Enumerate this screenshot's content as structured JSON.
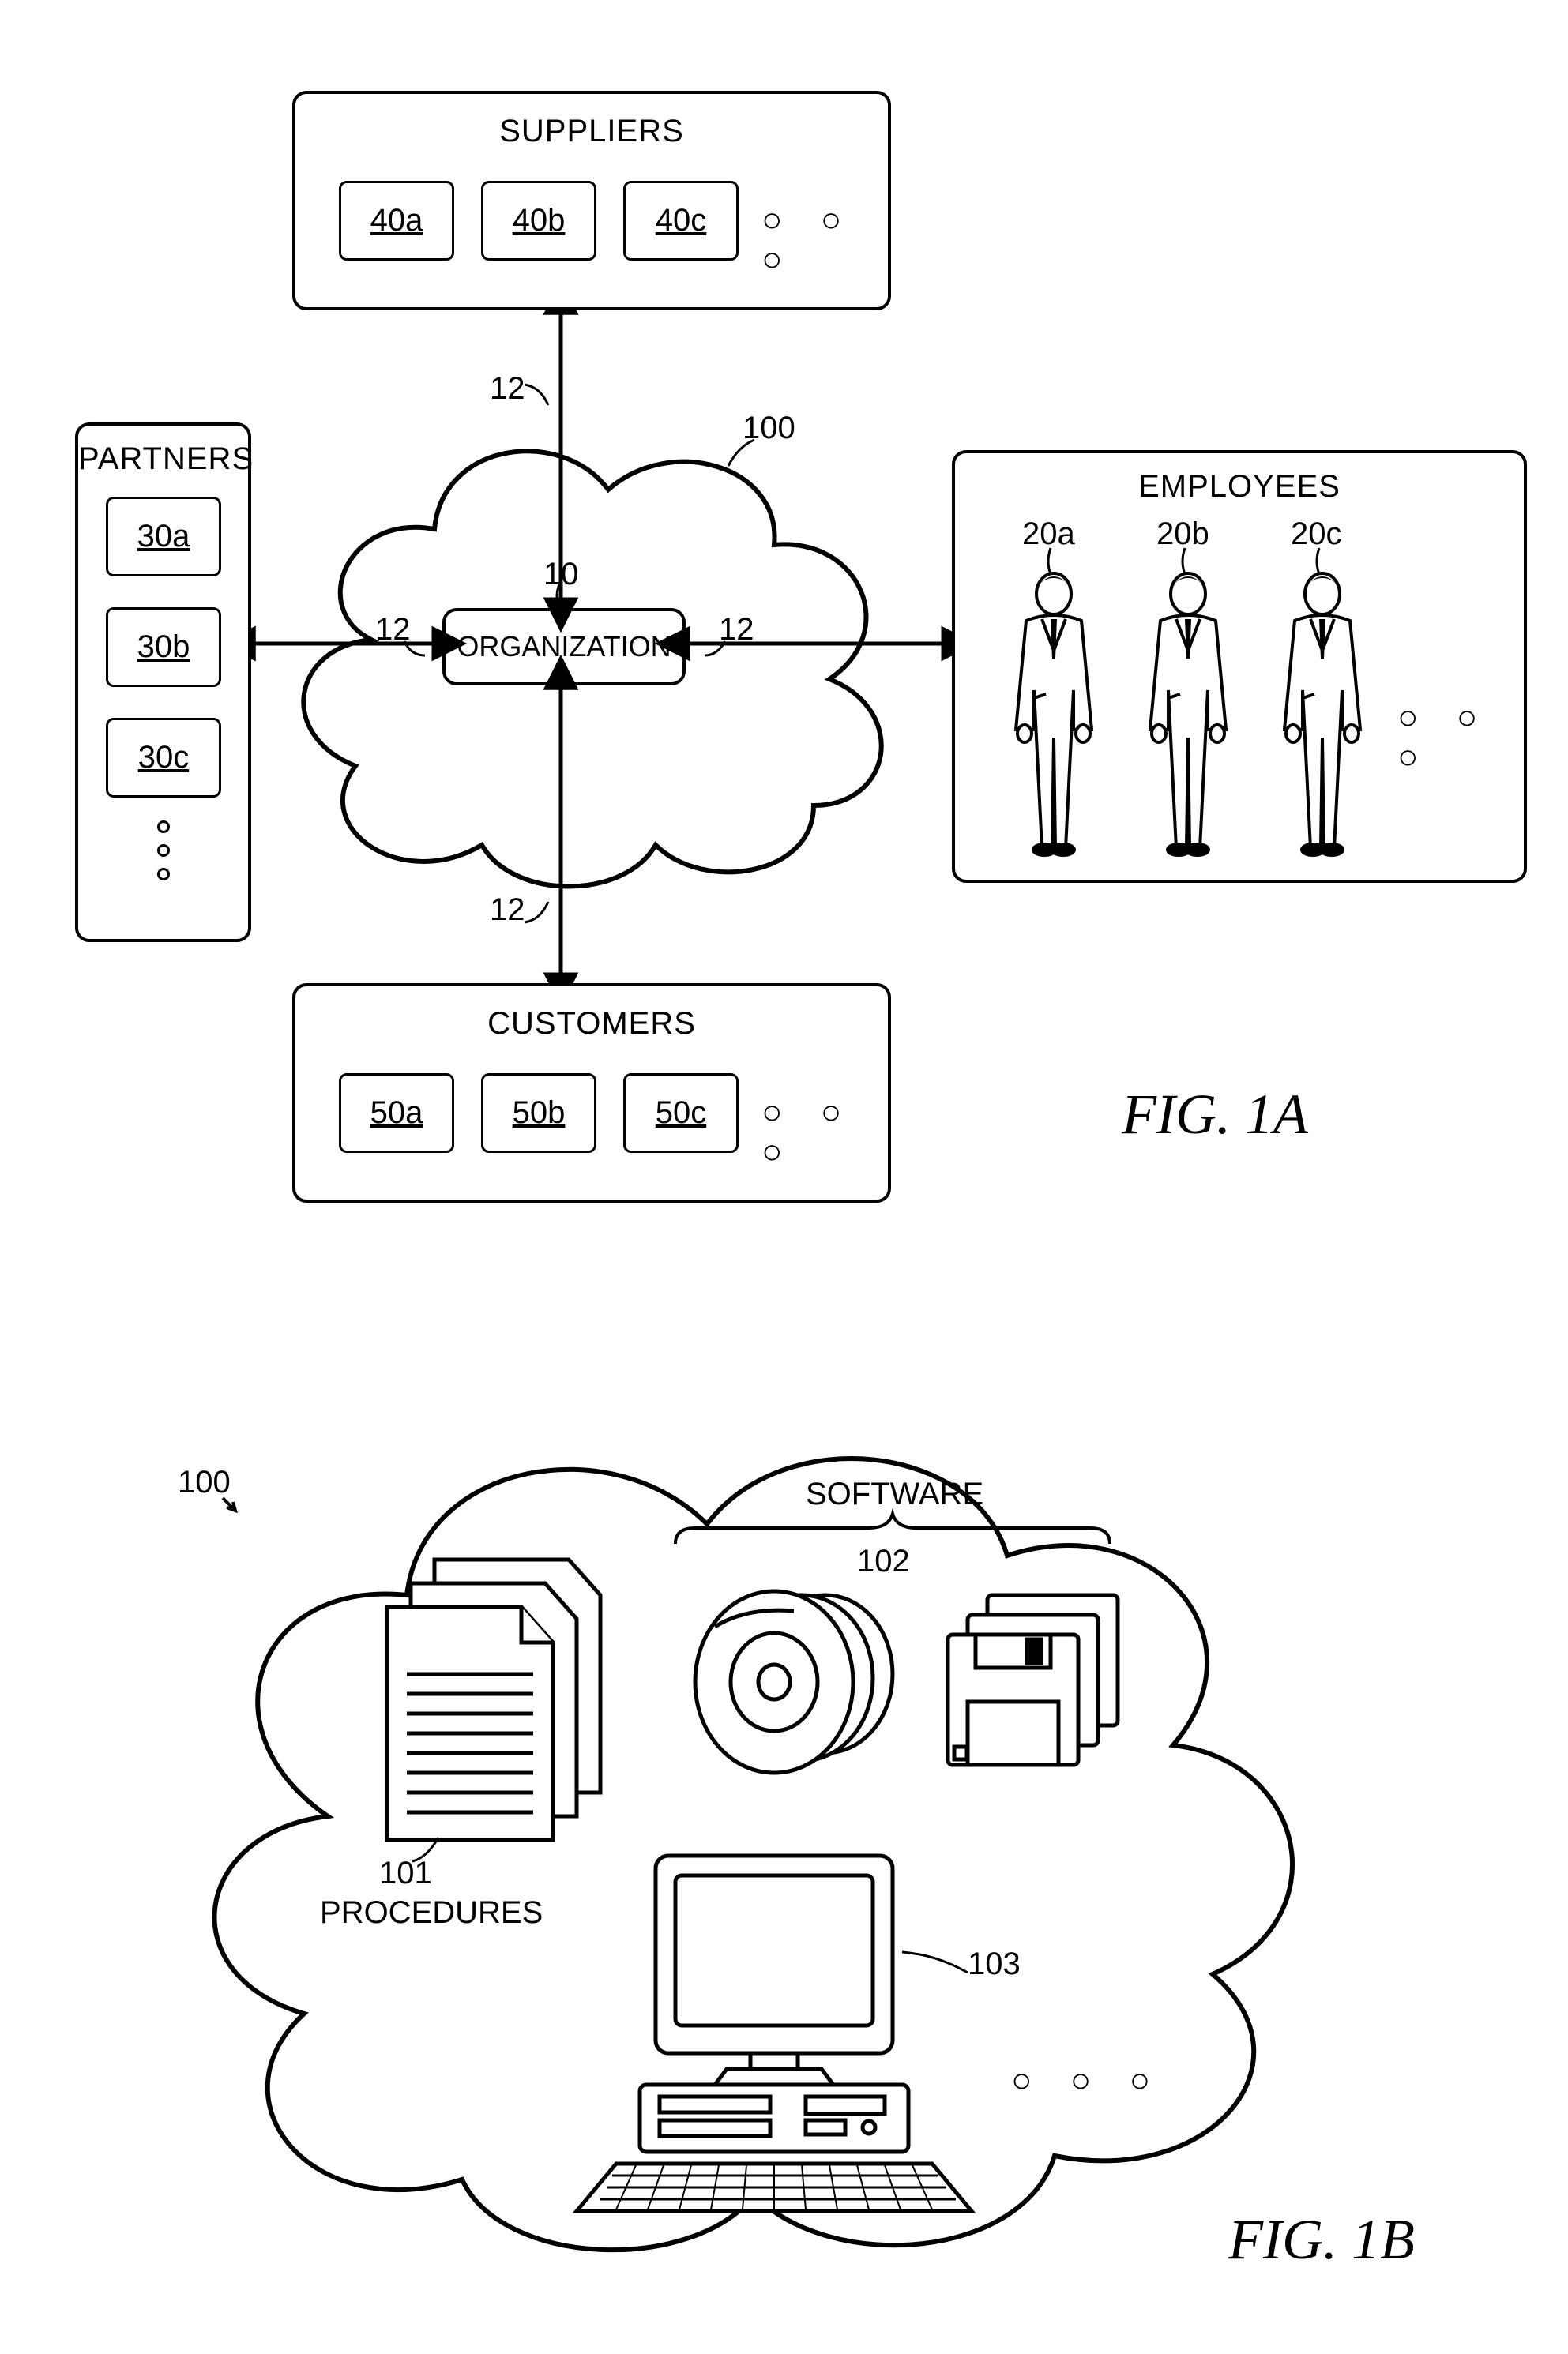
{
  "fig1a": {
    "caption": "FIG. 1A",
    "cloud_ref": "100",
    "arrow_ref": "12",
    "organization": {
      "ref": "10",
      "label": "ORGANIZATION"
    },
    "suppliers": {
      "title": "SUPPLIERS",
      "items": [
        "40a",
        "40b",
        "40c"
      ],
      "ellipsis": "○ ○ ○"
    },
    "partners": {
      "title": "PARTNERS",
      "items": [
        "30a",
        "30b",
        "30c"
      ]
    },
    "customers": {
      "title": "CUSTOMERS",
      "items": [
        "50a",
        "50b",
        "50c"
      ],
      "ellipsis": "○ ○ ○"
    },
    "employees": {
      "title": "EMPLOYEES",
      "items": [
        "20a",
        "20b",
        "20c"
      ],
      "ellipsis": "○ ○ ○"
    }
  },
  "fig1b": {
    "caption": "FIG. 1B",
    "cloud_ref": "100",
    "procedures": {
      "ref": "101",
      "label": "PROCEDURES"
    },
    "software": {
      "ref": "102",
      "label": "SOFTWARE"
    },
    "computer": {
      "ref": "103"
    },
    "ellipsis": "○ ○ ○"
  }
}
